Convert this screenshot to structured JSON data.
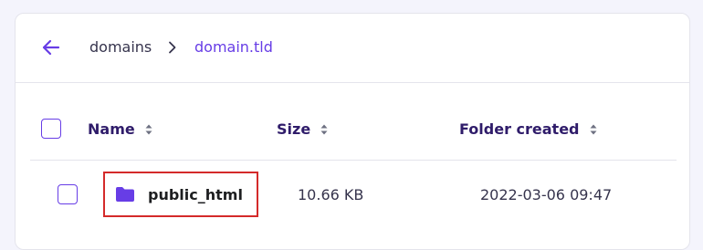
{
  "breadcrumb": {
    "items": [
      "domains",
      "domain.tld"
    ]
  },
  "table": {
    "columns": [
      {
        "label": "Name",
        "sortable": true
      },
      {
        "label": "Size",
        "sortable": true
      },
      {
        "label": "Folder created",
        "sortable": true
      }
    ],
    "rows": [
      {
        "type": "folder",
        "icon": "folder-icon",
        "name": "public_html",
        "size": "10.66 KB",
        "created": "2022-03-06 09:47",
        "highlighted": true
      }
    ]
  },
  "colors": {
    "accent": "#673de6",
    "highlight_border": "#d42a2a",
    "background": "#f4f4fc"
  }
}
